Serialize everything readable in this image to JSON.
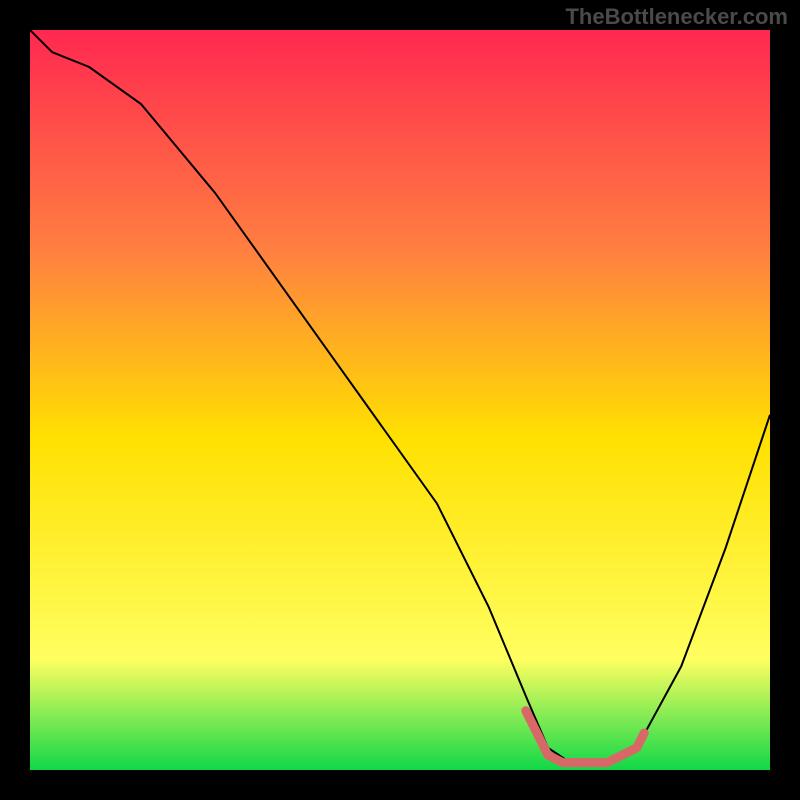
{
  "watermark": "TheBottlenecker.com",
  "chart_data": {
    "type": "line",
    "title": "",
    "xlabel": "",
    "ylabel": "",
    "xlim": [
      0,
      100
    ],
    "ylim": [
      0,
      100
    ],
    "background_gradient": {
      "top": "#ff2850",
      "mid_upper": "#ff8040",
      "mid": "#ffe000",
      "mid_lower": "#ffff60",
      "bottom": "#10d848"
    },
    "series": [
      {
        "name": "bottleneck-curve",
        "color": "#000000",
        "x": [
          0,
          3,
          8,
          15,
          25,
          35,
          45,
          55,
          62,
          67,
          70,
          73,
          78,
          82,
          88,
          94,
          100
        ],
        "y": [
          100,
          97,
          95,
          90,
          78,
          64,
          50,
          36,
          22,
          10,
          3,
          1,
          1,
          3,
          14,
          30,
          48
        ]
      },
      {
        "name": "optimal-range-marker",
        "color": "#d86868",
        "style": "thick",
        "x": [
          67,
          69,
          70,
          72,
          75,
          78,
          80,
          82,
          83
        ],
        "y": [
          8,
          4,
          2,
          1,
          1,
          1,
          2,
          3,
          5
        ]
      }
    ]
  }
}
